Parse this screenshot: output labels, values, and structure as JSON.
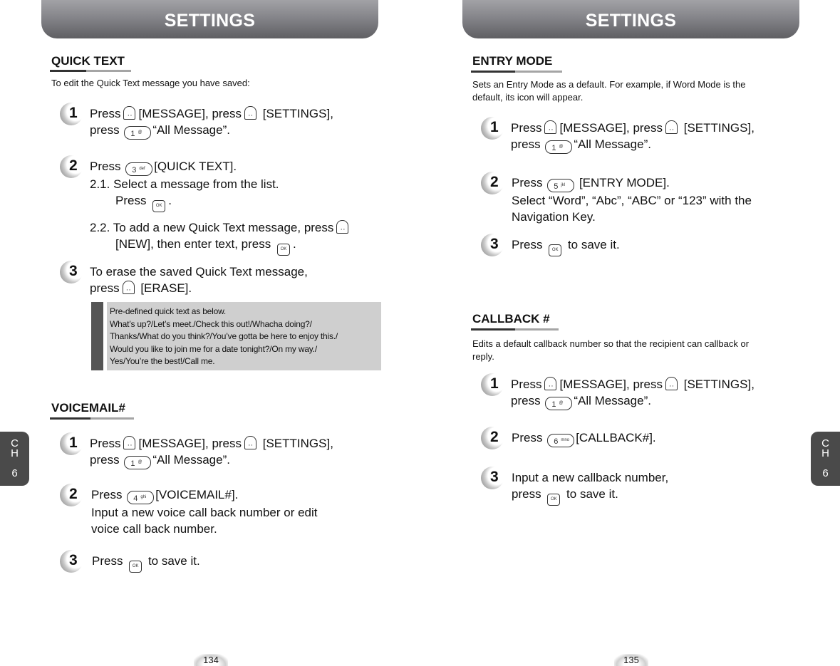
{
  "header": {
    "left_title": "SETTINGS",
    "right_title": "SETTINGS"
  },
  "chapter_tab": {
    "left": [
      "C",
      "H",
      "6"
    ],
    "right": [
      "C",
      "H",
      "6"
    ]
  },
  "page_numbers": {
    "left": "134",
    "right": "135"
  },
  "quick_text": {
    "title": "QUICK TEXT",
    "intro": "To edit the Quick Text message you have saved:",
    "steps": [
      {
        "num": "1",
        "l1a": "Press",
        "l1b": "[MESSAGE], press",
        "l1c": "[SETTINGS],",
        "l2a": "press",
        "l2b": "“All Message”."
      },
      {
        "num": "2",
        "l1a": "Press",
        "l1b": "[QUICK TEXT].",
        "s1": "2.1. Select a message from the list.",
        "s1b": "Press",
        "s1c": ".",
        "s2": "2.2. To add a new Quick Text message, press",
        "s2b": "[NEW], then enter text, press",
        "s2c": "."
      },
      {
        "num": "3",
        "l1": "To erase the saved Quick Text message,",
        "l2a": "press",
        "l2b": "[ERASE]."
      }
    ],
    "note": [
      "Pre-defined quick text as below.",
      "What’s up?/Let’s meet./Check this out!/Whacha doing?/",
      "Thanks/What do you think?/You’ve gotta be here to enjoy this./",
      "Would you like to join me for a date tonight?/On my way./",
      "Yes/You’re the best!/Call me."
    ]
  },
  "voicemail": {
    "title": "VOICEMAIL#",
    "steps": [
      {
        "num": "1",
        "l1a": "Press",
        "l1b": "[MESSAGE], press",
        "l1c": "[SETTINGS],",
        "l2a": "press",
        "l2b": "“All Message”."
      },
      {
        "num": "2",
        "l1a": "Press",
        "l1b": "[VOICEMAIL#].",
        "l2": "Input a new voice call back number or edit",
        "l3": "voice call back number."
      },
      {
        "num": "3",
        "l1a": "Press",
        "l1b": "to save it."
      }
    ]
  },
  "entry_mode": {
    "title": "ENTRY MODE",
    "intro1": "Sets an Entry Mode as a default. For example, if Word Mode is the",
    "intro2": "default, its icon will appear.",
    "steps": [
      {
        "num": "1",
        "l1a": "Press",
        "l1b": "[MESSAGE], press",
        "l1c": "[SETTINGS],",
        "l2a": "press",
        "l2b": "“All Message”."
      },
      {
        "num": "2",
        "l1a": "Press",
        "l1b": "[ENTRY MODE].",
        "l2": "Select “Word”, “Abc”, “ABC” or “123” with the",
        "l3": "Navigation Key."
      },
      {
        "num": "3",
        "l1a": "Press",
        "l1b": "to save it."
      }
    ]
  },
  "callback": {
    "title": "CALLBACK #",
    "intro1": "Edits a default callback number so that the recipient can callback or",
    "intro2": "reply.",
    "steps": [
      {
        "num": "1",
        "l1a": "Press",
        "l1b": "[MESSAGE], press",
        "l1c": "[SETTINGS],",
        "l2a": "press",
        "l2b": "“All Message”."
      },
      {
        "num": "2",
        "l1a": "Press",
        "l1b": "[CALLBACK#]."
      },
      {
        "num": "3",
        "l1": "Input a new callback number,",
        "l2a": "press",
        "l2b": "to save it."
      }
    ]
  },
  "keys": {
    "ok": "OK",
    "k1": "1",
    "k1_sub": "@",
    "k3": "3",
    "k3_sub": "def",
    "k4": "4",
    "k4_sub": "ghi",
    "k5": "5",
    "k5_sub": "jkl",
    "k6": "6",
    "k6_sub": "mno"
  }
}
